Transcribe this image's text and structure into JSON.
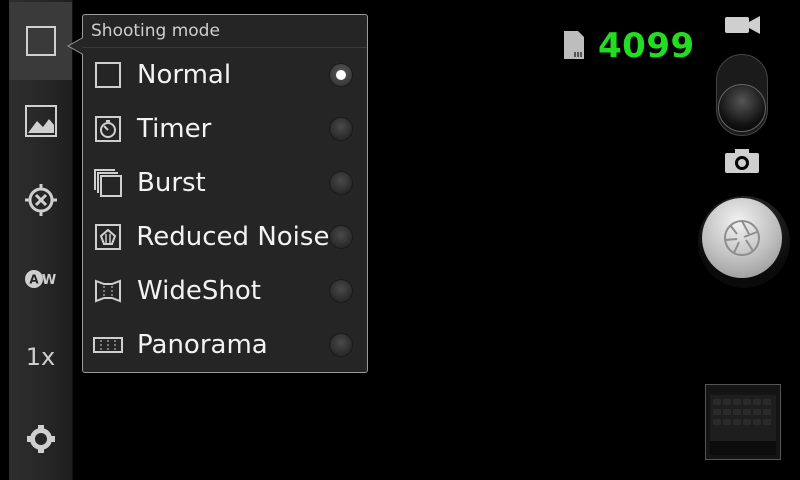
{
  "popup": {
    "title": "Shooting mode",
    "modes": [
      {
        "label": "Normal",
        "icon": "square-icon",
        "selected": true
      },
      {
        "label": "Timer",
        "icon": "timer-icon",
        "selected": false
      },
      {
        "label": "Burst",
        "icon": "burst-icon",
        "selected": false
      },
      {
        "label": "Reduced Noise",
        "icon": "reduced-noise-icon",
        "selected": false
      },
      {
        "label": "WideShot",
        "icon": "wideshot-icon",
        "selected": false
      },
      {
        "label": "Panorama",
        "icon": "panorama-icon",
        "selected": false
      }
    ]
  },
  "rail": {
    "items": [
      {
        "name": "shooting-mode",
        "icon": "square-icon"
      },
      {
        "name": "scene",
        "icon": "landscape-icon"
      },
      {
        "name": "focus",
        "icon": "focus-target-icon"
      },
      {
        "name": "white-balance",
        "icon": "auto-wb-icon"
      },
      {
        "name": "zoom",
        "text": "1x"
      },
      {
        "name": "settings",
        "icon": "gear-icon"
      }
    ]
  },
  "status": {
    "remaining_shots": "4099",
    "counter_color": "#22dd22"
  },
  "controls": {
    "mode_switch": "camera",
    "icons": [
      "video-camera-icon",
      "camera-icon",
      "shutter-icon",
      "thumbnail"
    ]
  }
}
